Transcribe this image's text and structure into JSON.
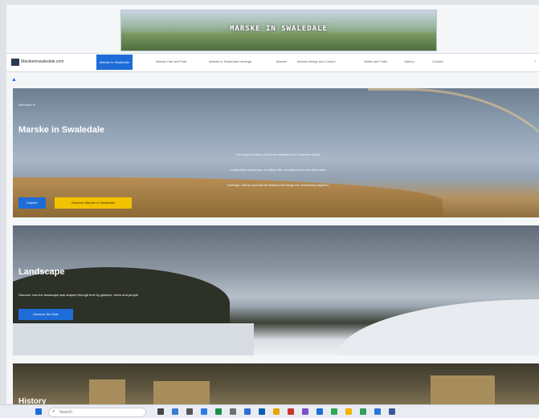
{
  "banner": {
    "title": "MARSKE IN SWALEDALE"
  },
  "navbar": {
    "site_name": "Marskeinswaledale.com",
    "items": [
      "Marske in Swaledale",
      "Marske Hall and Park",
      "Marske in Swaledale Heritage",
      "Marske",
      "Marske Bridge and Church",
      "Walks and Trails",
      "Gallery",
      "Contact"
    ]
  },
  "hero": {
    "eyebrow": "Welcome to",
    "title": "Marske in Swaledale",
    "lines": [
      "The unspoilt valley of Marske nestled in the Yorkshire Dales",
      "Undisturbed landscape of rolling hills, woodland and riverside walks",
      "Heritage, history and natural beauty that brings the community together"
    ],
    "primary_button": "Explore",
    "secondary_button": "Discover Marske in Swaledale"
  },
  "landscape": {
    "title": "Landscape",
    "body": "Discover how the landscape was shaped through time by glaciers, rivers and people",
    "button": "Discover the Dale"
  },
  "history": {
    "title": "History"
  },
  "taskbar": {
    "search_placeholder": "Search"
  },
  "colors": {
    "accent": "#1e6cd8",
    "highlight": "#f2c200"
  }
}
